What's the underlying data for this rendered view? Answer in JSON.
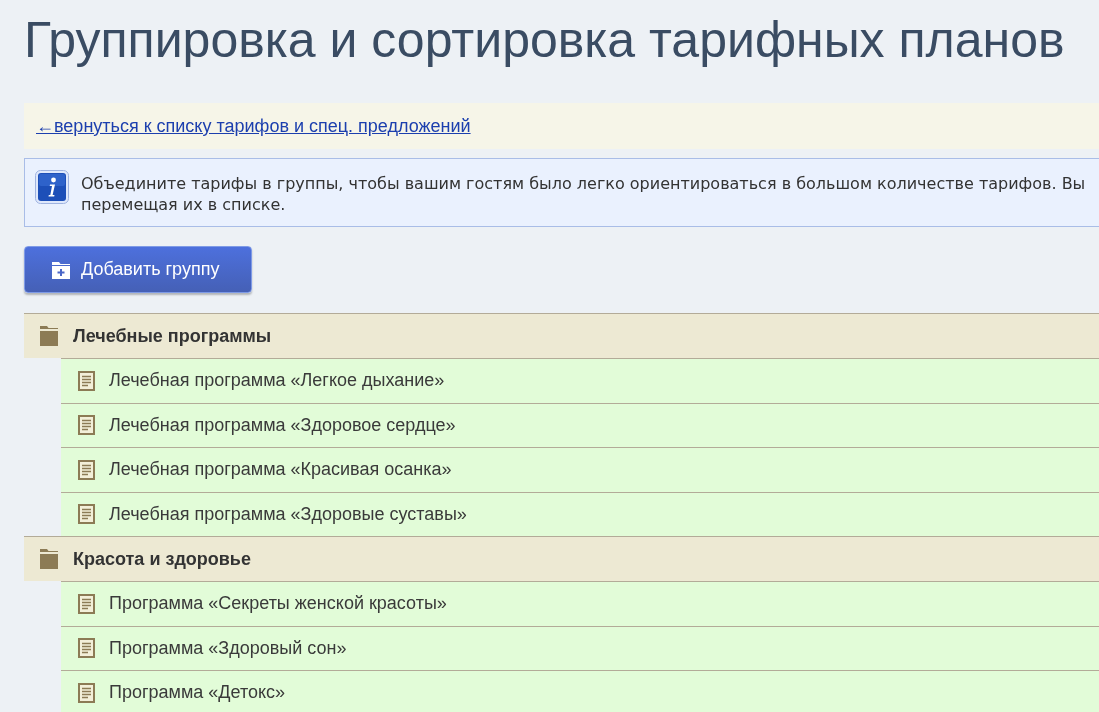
{
  "page": {
    "title": "Группировка и сортировка тарифных планов"
  },
  "back_link": {
    "text": "←вернуться к списку тарифов и спец. предложений"
  },
  "info": {
    "lines": [
      "Объедините тарифы в группы, чтобы вашим гостям было легко ориентироваться в большом количестве тарифов. Вы",
      "перемещая их в списке."
    ]
  },
  "add_group_button": {
    "label": "Добавить группу"
  },
  "groups": [
    {
      "title": "Лечебные программы",
      "children": [
        {
          "title": "Лечебная программа «Легкое дыхание»"
        },
        {
          "title": "Лечебная программа «Здоровое сердце»"
        },
        {
          "title": "Лечебная программа «Красивая осанка»"
        },
        {
          "title": "Лечебная программа «Здоровые суставы»"
        }
      ]
    },
    {
      "title": "Красота и здоровье",
      "children": [
        {
          "title": "Программа «Секреты женской красоты»"
        },
        {
          "title": "Программа «Здоровый сон»"
        },
        {
          "title": "Программа «Детокс»"
        }
      ]
    }
  ]
}
